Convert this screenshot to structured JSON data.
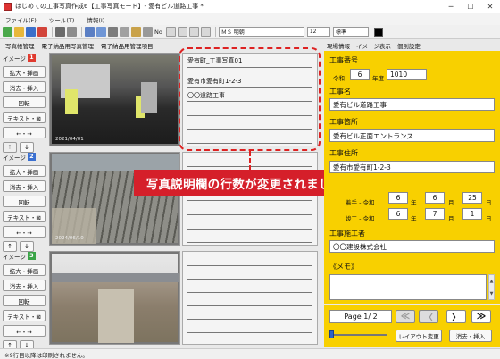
{
  "window": {
    "title": "はじめての工事写真作成6【工事写真モード】- 愛有ビル道路工事 *"
  },
  "menu": [
    "ファイル(F)",
    "ツール(T)",
    "情報(I)"
  ],
  "toolbar": {
    "no_label": "No",
    "font": "ＭＳ 明朝",
    "font_size": "12",
    "style": "標準"
  },
  "tabs_left": [
    "写真帳管理",
    "電子納品用写真管理",
    "電子納品用管理項目"
  ],
  "tabs_right": [
    "現場情報",
    "イメージ表示",
    "個別設定"
  ],
  "sidebar": {
    "groups": [
      {
        "label": "イメージ",
        "num": "1",
        "color": "#e03a2f"
      },
      {
        "label": "イメージ",
        "num": "2",
        "color": "#3a6fd0"
      },
      {
        "label": "イメージ",
        "num": "3",
        "color": "#3aa447"
      }
    ],
    "buttons": {
      "enlarge": "拡大・挿画",
      "delete_insert": "消去・挿入",
      "rotate": "回転",
      "text": "テキスト・⊠",
      "swap": "←・→"
    },
    "arrows": {
      "up": "↑",
      "down": "↓"
    }
  },
  "photos": [
    {
      "stamp": "2021/04/01"
    },
    {
      "stamp": "2024/06/10"
    },
    {
      "stamp": ""
    }
  ],
  "description": {
    "lines": [
      "愛有町_工事写真01",
      "愛有市愛有町1-2-3",
      "〇〇道路工事"
    ]
  },
  "banner": "写真説明欄の行数が変更されました。",
  "info": {
    "koji_bango_label": "工事番号",
    "reiwa": "令和",
    "year": "6",
    "nendo": "年度",
    "number": "1010",
    "koji_mei_label": "工事名",
    "koji_mei": "愛有ビル道路工事",
    "kasho_label": "工事箇所",
    "kasho": "愛有ビル正面エントランス",
    "jusho_label": "工事住所",
    "jusho": "愛有市愛有町1-2-3",
    "chakko_label": "着手 - 令和",
    "chakko": [
      "6",
      "6",
      "25"
    ],
    "shunko_label": "竣工 - 令和",
    "shunko": [
      "6",
      "7",
      "1"
    ],
    "unit_year": "年",
    "unit_month": "月",
    "unit_day": "日",
    "sekosha_label": "工事施工者",
    "sekosha": "〇〇建設株式会社",
    "memo_label": "《メモ》"
  },
  "nav": {
    "page": "Page 1/ 2",
    "first": "≪",
    "prev": "〈",
    "next": "〉",
    "last": "≫",
    "layout_btn": "レイアウト変更",
    "delete_insert_btn": "消去・挿入"
  },
  "status": "※9行目以降は印刷されません。"
}
